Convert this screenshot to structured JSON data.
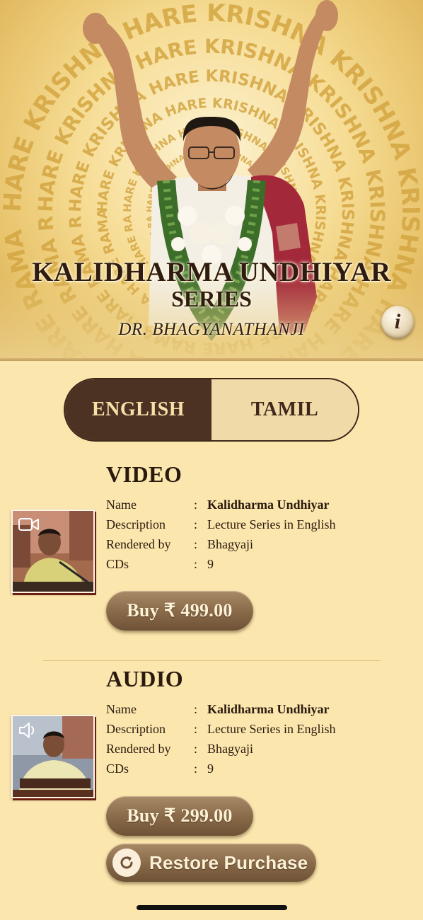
{
  "hero": {
    "title": "KALIDHARMA UNDHIYAR",
    "subtitle": "SERIES",
    "author": "DR. BHAGYANATHANJI",
    "mantra_text": "HARE KRISHNA HARE KRISHNA KRISHNA KRISHNA HARE HARE HARE RAMA HARE RAMA RAMA RAMA HARE HARE",
    "info_glyph": "i"
  },
  "language_tabs": {
    "items": [
      {
        "label": "ENGLISH",
        "selected": true
      },
      {
        "label": "TAMIL",
        "selected": false
      }
    ]
  },
  "products": [
    {
      "heading": "VIDEO",
      "thumb_icon": "video-camera-icon",
      "details": [
        {
          "label": "Name",
          "colon": ":",
          "value": "Kalidharma Undhiyar"
        },
        {
          "label": "Description",
          "colon": ":",
          "value": "Lecture Series in English"
        },
        {
          "label": "Rendered by",
          "colon": ":",
          "value": "Bhagyaji"
        },
        {
          "label": "CDs",
          "colon": ":",
          "value": "9"
        }
      ],
      "buy_label": "Buy ₹ 499.00"
    },
    {
      "heading": "AUDIO",
      "thumb_icon": "speaker-icon",
      "details": [
        {
          "label": "Name",
          "colon": ":",
          "value": "Kalidharma Undhiyar"
        },
        {
          "label": "Description",
          "colon": ":",
          "value": "Lecture Series in English"
        },
        {
          "label": "Rendered by",
          "colon": ":",
          "value": "Bhagyaji"
        },
        {
          "label": "CDs",
          "colon": ":",
          "value": "9"
        }
      ],
      "buy_label": "Buy ₹ 299.00"
    }
  ],
  "restore": {
    "label": "Restore Purchase",
    "icon": "refresh-icon"
  },
  "colors": {
    "background": "#fbe7ae",
    "tab_active": "#4b3222",
    "tab_inactive": "#efdaa8",
    "button": "#8a6b4a",
    "text": "#2a1a0e"
  }
}
